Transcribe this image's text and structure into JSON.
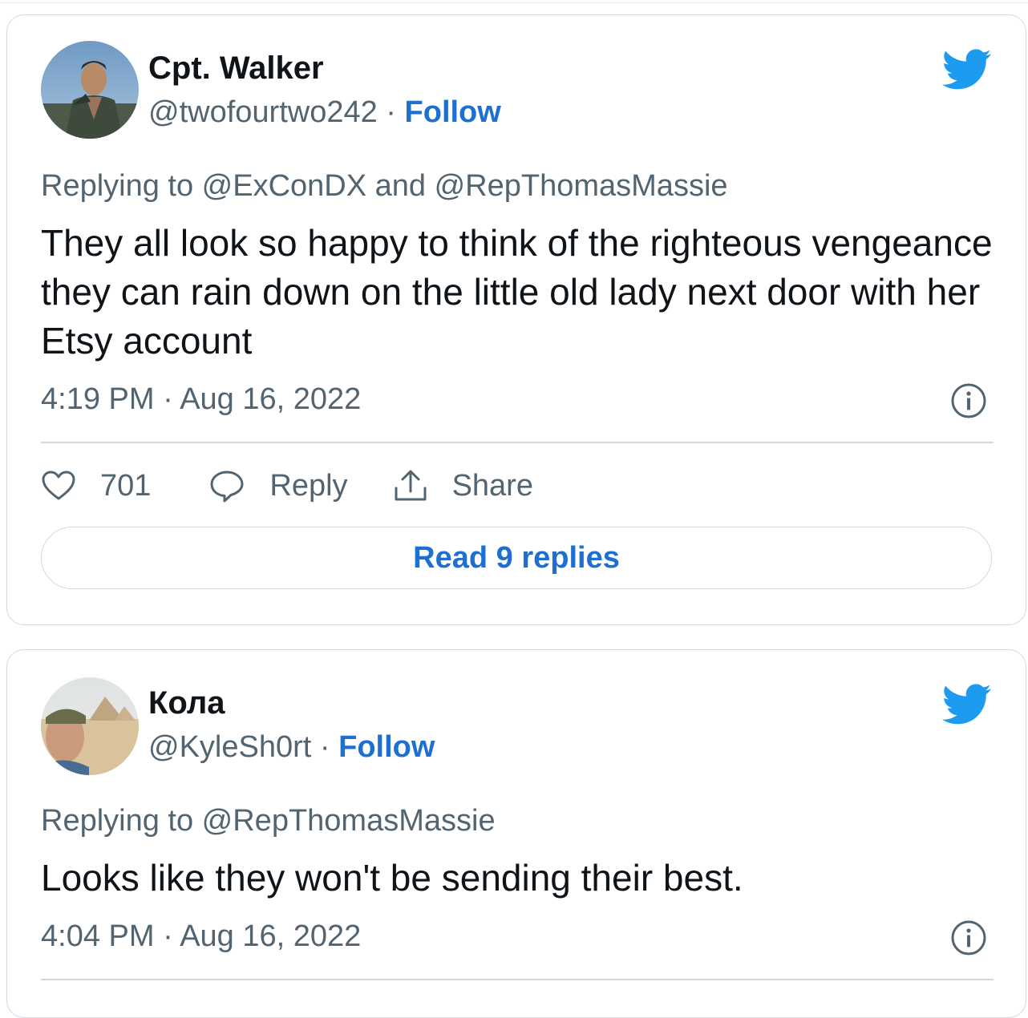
{
  "tweets": [
    {
      "name": "Cpt. Walker",
      "handle": "@twofourtwo242",
      "separator": "·",
      "follow_label": "Follow",
      "replying_to": "Replying to @ExConDX and @RepThomasMassie",
      "text": "They all look so happy to think of the righteous vengeance they can rain down on the little old lady next door with her Etsy account",
      "timestamp": "4:19 PM · Aug 16, 2022",
      "like_count": "701",
      "reply_label": "Reply",
      "share_label": "Share",
      "read_replies_label": "Read 9 replies",
      "avatar_icon": "avatar-photo-man-portrait"
    },
    {
      "name": "Кола",
      "handle": "@KyleSh0rt",
      "separator": "·",
      "follow_label": "Follow",
      "replying_to": "Replying to @RepThomasMassie",
      "text": "Looks like they won't be sending their best.",
      "timestamp": "4:04 PM · Aug 16, 2022",
      "avatar_icon": "avatar-photo-pyramids-selfie"
    }
  ],
  "icons": {
    "brand": "twitter-bird-icon",
    "info": "info-circle-icon",
    "like": "heart-icon",
    "reply": "speech-bubble-icon",
    "share": "share-upload-icon"
  },
  "colors": {
    "brand_blue": "#1d9bf0",
    "link_blue": "#1d6fd2",
    "secondary_text": "#536471",
    "primary_text": "#0f1419",
    "border": "#cfd9de"
  }
}
